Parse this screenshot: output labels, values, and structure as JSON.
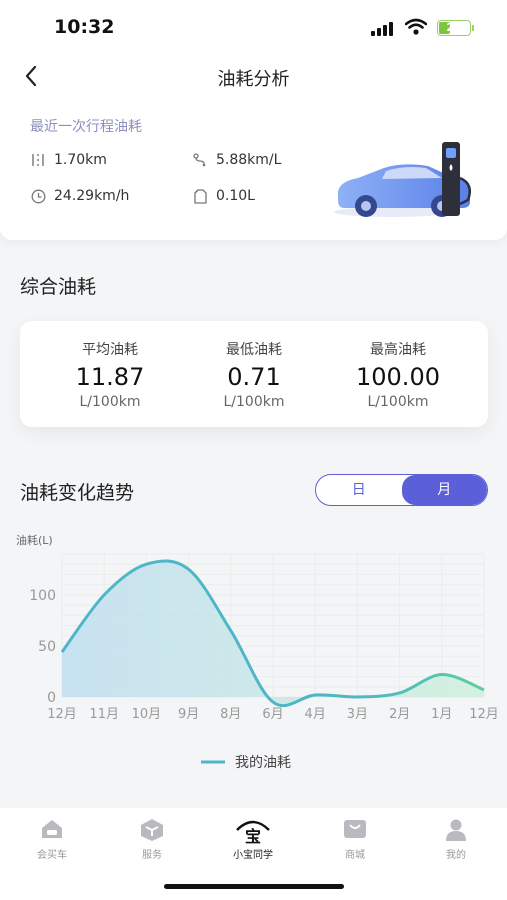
{
  "status_bar": {
    "time": "10:32",
    "battery": "22"
  },
  "nav": {
    "back_icon": "chevron-left-icon",
    "title": "油耗分析"
  },
  "trip": {
    "label": "最近一次行程油耗",
    "distance": "1.70km",
    "economy": "5.88km/L",
    "avg_speed": "24.29km/h",
    "fuel_used": "0.10L"
  },
  "summary": {
    "title": "综合油耗",
    "items": [
      {
        "label": "平均油耗",
        "value": "11.87",
        "unit": "L/100km"
      },
      {
        "label": "最低油耗",
        "value": "0.71",
        "unit": "L/100km"
      },
      {
        "label": "最高油耗",
        "value": "100.00",
        "unit": "L/100km"
      }
    ]
  },
  "trend": {
    "title": "油耗变化趋势",
    "toggle": {
      "day": "日",
      "month": "月",
      "selected": "月"
    }
  },
  "chart_data": {
    "type": "area",
    "ylabel": "油耗(L)",
    "ylim": [
      0,
      140
    ],
    "yticks": [
      0,
      50,
      100
    ],
    "categories": [
      "12月",
      "11月",
      "10月",
      "9月",
      "8月",
      "6月",
      "4月",
      "3月",
      "2月",
      "1月",
      "12月"
    ],
    "series": [
      {
        "name": "我的油耗",
        "values": [
          44,
          100,
          130,
          125,
          65,
          -5,
          2,
          0,
          4,
          22,
          7
        ]
      }
    ],
    "legend": "bottom-center",
    "colors": {
      "line": "#4fb6c8",
      "line_end": "#5ccca0",
      "fill_start": "#b9dcef",
      "fill_end": "#c9efd9"
    },
    "grid": true
  },
  "tabbar": {
    "items": [
      {
        "label": "会买车",
        "icon": "car-shop-icon"
      },
      {
        "label": "服务",
        "icon": "cube-icon"
      },
      {
        "label": "小宝同学",
        "icon": "baby-assistant-icon",
        "active": true
      },
      {
        "label": "商城",
        "icon": "shopping-bag-icon"
      },
      {
        "label": "我的",
        "icon": "user-icon"
      }
    ]
  }
}
